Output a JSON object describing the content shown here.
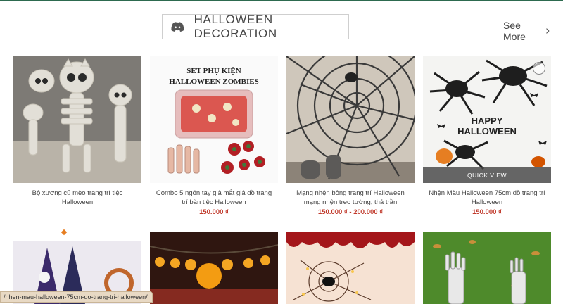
{
  "section": {
    "title": "HALLOWEEN DECORATION",
    "see_more": "See More"
  },
  "products": [
    {
      "name": "Bộ xương củ mèo trang trí tiệc Halloween",
      "price": "",
      "image_label": ""
    },
    {
      "name": "Combo 5 ngón tay giả mắt giả đồ trang trí bàn tiệc Halloween",
      "price": "150.000 ₫",
      "image_label": "SET PHỤ KIỆN HALLOWEEN ZOMBIES"
    },
    {
      "name": "Mạng nhện bông trang trí Halloween mạng nhện treo tường, thả trần",
      "price": "150.000 ₫ - 200.000 ₫",
      "image_label": ""
    },
    {
      "name": "Nhện Màu Halloween 75cm đồ trang trí Halloween",
      "price": "150.000 ₫",
      "image_label": "HAPPY HALLOWEEN",
      "quick_view": "QUICK VIEW"
    }
  ],
  "status_url": "/nhen-mau-halloween-75cm-do-trang-tri-halloween/",
  "colors": {
    "price": "#c0392b",
    "accent_top": "#2d6a4f"
  }
}
